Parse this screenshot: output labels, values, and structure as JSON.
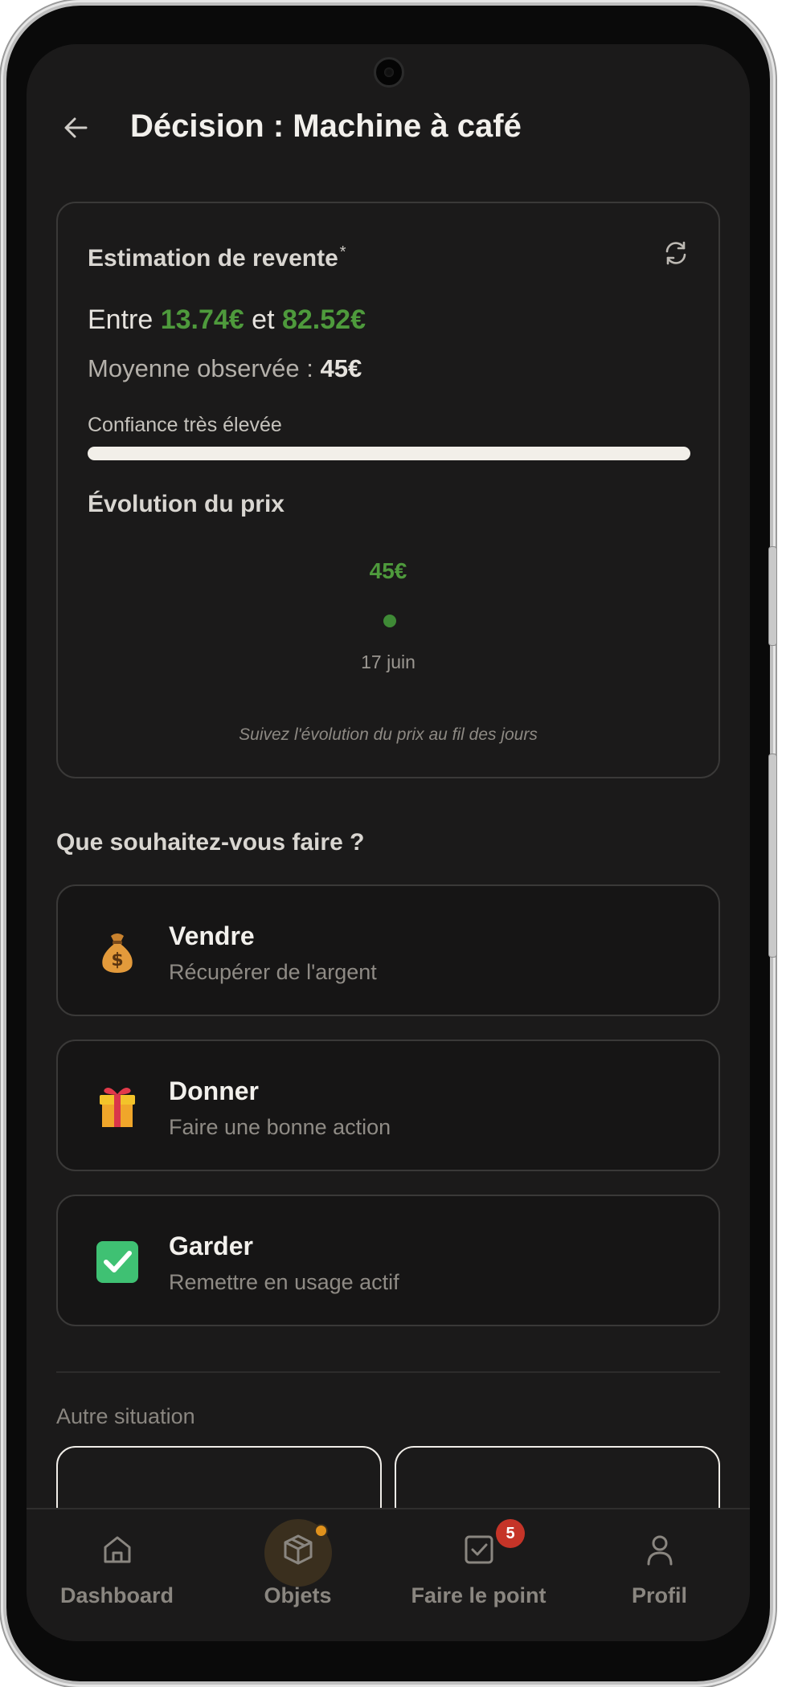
{
  "header": {
    "title": "Décision : Machine à café"
  },
  "estimation": {
    "title": "Estimation de revente",
    "asterisk": "*",
    "range_prefix": "Entre",
    "range_low": "13.74€",
    "range_mid": "et",
    "range_high": "82.52€",
    "avg_label": "Moyenne observée :",
    "avg_value": "45€",
    "confidence_label": "Confiance très élevée",
    "confidence_level": 1.0,
    "evolution_title": "Évolution du prix",
    "point_value": "45€",
    "point_date": "17 juin",
    "caption": "Suivez l'évolution du prix au fil des jours"
  },
  "question": "Que souhaitez-vous faire ?",
  "options": [
    {
      "title": "Vendre",
      "subtitle": "Récupérer de l'argent",
      "icon": "money-bag-icon"
    },
    {
      "title": "Donner",
      "subtitle": "Faire une bonne action",
      "icon": "gift-icon"
    },
    {
      "title": "Garder",
      "subtitle": "Remettre en usage actif",
      "icon": "check-box-icon"
    }
  ],
  "other": {
    "label": "Autre situation"
  },
  "nav": {
    "items": [
      {
        "label": "Dashboard",
        "icon": "home-icon"
      },
      {
        "label": "Objets",
        "icon": "box-icon"
      },
      {
        "label": "Faire le point",
        "icon": "checklist-icon",
        "badge": "5"
      },
      {
        "label": "Profil",
        "icon": "user-icon"
      }
    ]
  },
  "colors": {
    "accent_green": "#4e9a3c",
    "badge_red": "#c53428",
    "active_orange": "#e1921c",
    "background": "#1b1a1a"
  }
}
